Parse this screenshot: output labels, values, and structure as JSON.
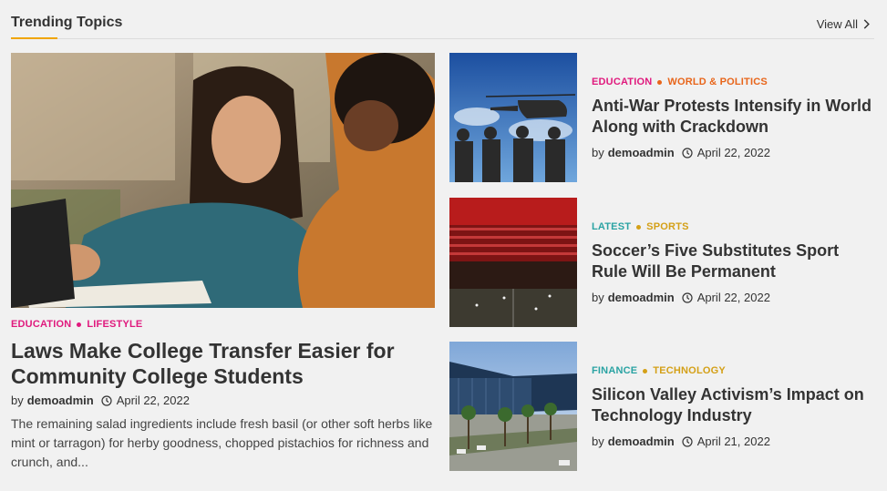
{
  "header": {
    "title": "Trending Topics",
    "view_all": "View All",
    "accent": "#f0a500"
  },
  "featured": {
    "categories": [
      {
        "label": "EDUCATION",
        "color": "#e0197d"
      },
      {
        "label": "LIFESTYLE",
        "color": "#e0197d"
      }
    ],
    "title": "Laws Make College Transfer Easier for Community College Students",
    "by": "by",
    "author": "demoadmin",
    "date": "April 22, 2022",
    "excerpt": "The remaining salad ingredients include fresh basil (or other soft herbs like mint or tarragon) for herby goodness, chopped pistachios for richness and crunch, and..."
  },
  "posts": [
    {
      "categories": [
        {
          "label": "EDUCATION",
          "color": "#e0197d"
        },
        {
          "label": "WORLD & POLITICS",
          "color": "#e8651a"
        }
      ],
      "title": "Anti-War Protests Intensify in World Along with Crackdown",
      "by": "by",
      "author": "demoadmin",
      "date": "April 22, 2022"
    },
    {
      "categories": [
        {
          "label": "LATEST",
          "color": "#2aa3a3"
        },
        {
          "label": "SPORTS",
          "color": "#d4a017"
        }
      ],
      "title": "Soccer’s Five Substitutes Sport Rule Will Be Permanent",
      "by": "by",
      "author": "demoadmin",
      "date": "April 22, 2022"
    },
    {
      "categories": [
        {
          "label": "FINANCE",
          "color": "#2aa3a3"
        },
        {
          "label": "TECHNOLOGY",
          "color": "#d4a017"
        }
      ],
      "title": "Silicon Valley Activism’s Impact on Technology Industry",
      "by": "by",
      "author": "demoadmin",
      "date": "April 21, 2022"
    }
  ]
}
